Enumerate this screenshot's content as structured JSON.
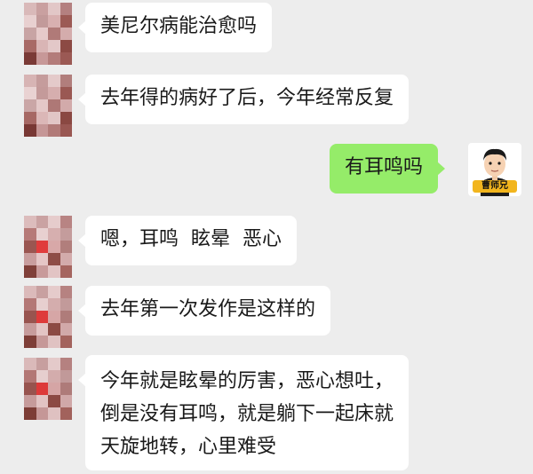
{
  "chat": {
    "messages": [
      {
        "side": "left",
        "text": "美尼尔病能治愈吗"
      },
      {
        "side": "left",
        "text": "去年得的病好了后，今年经常反复"
      },
      {
        "side": "right",
        "text": "有耳鸣吗"
      },
      {
        "side": "left",
        "text": "嗯，耳鸣  眩晕  恶心"
      },
      {
        "side": "left",
        "text": "去年第一次发作是这样的"
      },
      {
        "side": "left",
        "lines": [
          "今年就是眩晕的厉害，恶心想吐，",
          "倒是没有耳鸣，就是躺下一起床就",
          "天旋地转，心里难受"
        ]
      }
    ]
  },
  "self_avatar": {
    "logo_text": "曹师兄"
  },
  "colors": {
    "background": "#ededed",
    "incoming_bubble": "#ffffff",
    "outgoing_bubble": "#95ec69"
  }
}
